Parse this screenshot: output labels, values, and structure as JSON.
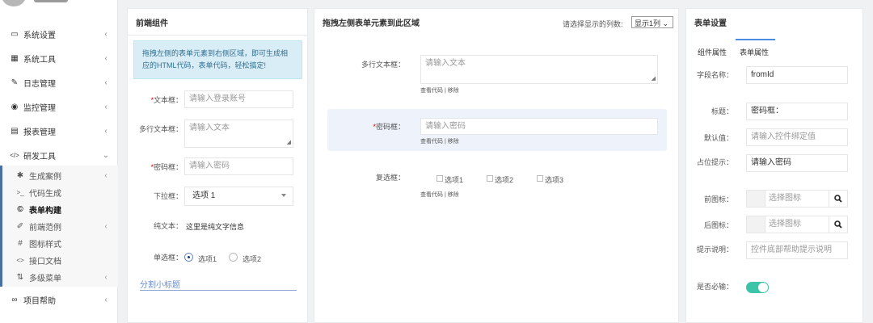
{
  "sidebar": {
    "items": [
      {
        "label": "系统设置",
        "icon": "monitor-icon",
        "glyph": "▭",
        "arrow": "‹"
      },
      {
        "label": "系统工具",
        "icon": "windows-icon",
        "glyph": "▦",
        "arrow": "‹"
      },
      {
        "label": "日志管理",
        "icon": "edit-icon",
        "glyph": "✎",
        "arrow": "‹"
      },
      {
        "label": "监控管理",
        "icon": "eye-icon",
        "glyph": "◉",
        "arrow": "‹"
      },
      {
        "label": "报表管理",
        "icon": "file-icon",
        "glyph": "▤",
        "arrow": "‹"
      },
      {
        "label": "研发工具",
        "icon": "code-icon",
        "glyph": "</>",
        "arrow": "⌄"
      },
      {
        "label": "项目帮助",
        "icon": "link-icon",
        "glyph": "∞",
        "arrow": "‹"
      }
    ],
    "sub_items": [
      {
        "label": "生成案例",
        "icon": "paint-icon",
        "glyph": "✱",
        "arrow": "‹",
        "active": false
      },
      {
        "label": "代码生成",
        "icon": "terminal-icon",
        "glyph": ">_",
        "arrow": "",
        "active": false
      },
      {
        "label": "表单构建",
        "icon": "copyright-icon",
        "glyph": "©",
        "arrow": "",
        "active": true
      },
      {
        "label": "前端范例",
        "icon": "pencil-icon",
        "glyph": "✐",
        "arrow": "‹",
        "active": false
      },
      {
        "label": "图标样式",
        "icon": "hash-icon",
        "glyph": "#",
        "arrow": "",
        "active": false
      },
      {
        "label": "接口文档",
        "icon": "code-icon",
        "glyph": "<>",
        "arrow": "",
        "active": false
      },
      {
        "label": "多级菜单",
        "icon": "sort-icon",
        "glyph": "⇅",
        "arrow": "‹",
        "active": false
      }
    ]
  },
  "left_panel": {
    "title": "前端组件",
    "info": "拖拽左侧的表单元素到右侧区域，即可生成相应的HTML代码，表单代码，轻松搞定!",
    "text_field": {
      "label": "文本框：",
      "placeholder": "请输入登录账号"
    },
    "textarea": {
      "label": "多行文本框：",
      "placeholder": "请输入文本"
    },
    "password": {
      "label": "密码框：",
      "placeholder": "请输入密码"
    },
    "select": {
      "label": "下拉框：",
      "value": "选项 1"
    },
    "static": {
      "label": "纯文本：",
      "value": "这里是纯文字信息"
    },
    "radio": {
      "label": "单选框：",
      "options": [
        "选项1",
        "选项2"
      ],
      "selected_index": 0
    },
    "divider": "分割小标题"
  },
  "middle_panel": {
    "title": "拖拽左侧表单元素到此区域",
    "columns_label": "请选择显示的列数:",
    "columns_value": "显示1列",
    "rows": [
      {
        "label": "多行文本框：",
        "placeholder": "请输入文本",
        "actions": "查看代码 | 移除"
      },
      {
        "label": "密码框：",
        "placeholder": "请输入密码",
        "actions": "查看代码 | 移除"
      },
      {
        "label": "复选框：",
        "options": [
          "选项1",
          "选项2",
          "选项3"
        ],
        "actions": "查看代码 | 移除"
      }
    ]
  },
  "right_panel": {
    "title": "表单设置",
    "tabs": [
      "组件属性",
      "表单属性"
    ],
    "active_tab": 1,
    "fields": {
      "name": {
        "label": "字段名称：",
        "value": "fromId"
      },
      "title": {
        "label": "标题：",
        "value": "密码框："
      },
      "default": {
        "label": "默认值：",
        "placeholder": "请输入控件绑定值"
      },
      "placeholder": {
        "label": "占位提示：",
        "value": "请输入密码"
      },
      "pre_icon": {
        "label": "前图标：",
        "placeholder": "选择图标"
      },
      "post_icon": {
        "label": "后图标：",
        "placeholder": "选择图标"
      },
      "help": {
        "label": "提示说明：",
        "placeholder": "控件底部帮助提示说明"
      },
      "required": {
        "label": "是否必输：",
        "checked": true
      }
    }
  },
  "colors": {
    "accent": "#4a8de0",
    "toggle_on": "#3cc4a8",
    "required": "#e00000",
    "info_bg": "#d9edf7"
  }
}
